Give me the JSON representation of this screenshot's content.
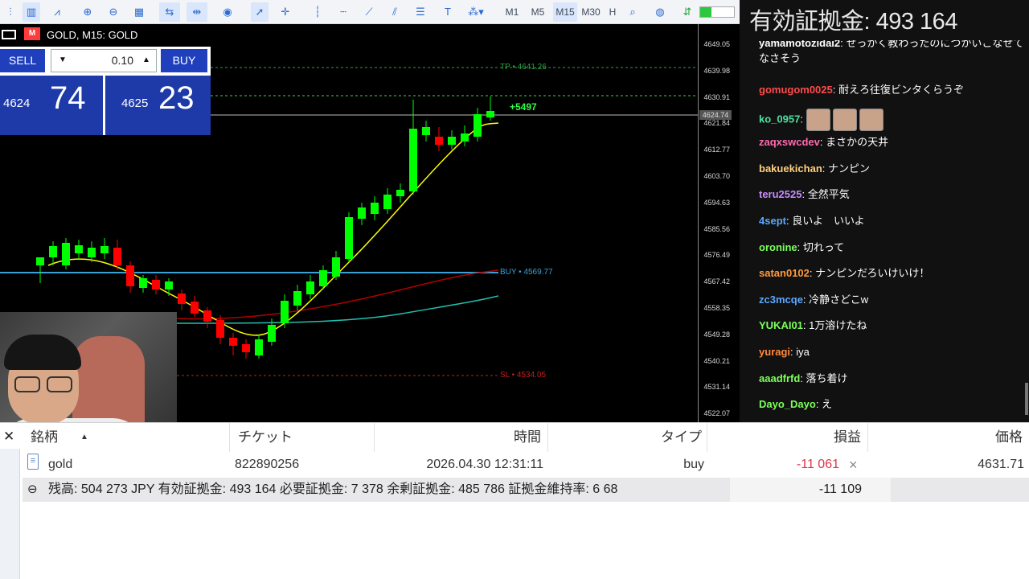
{
  "toolbar": {
    "timeframes": [
      "M1",
      "M5",
      "M15",
      "M30",
      "H"
    ],
    "selected_timeframe": "M15"
  },
  "overlay": {
    "balance_text": "有効証拠金: 493 164"
  },
  "chart": {
    "title": "GOLD, M15: GOLD",
    "sell_label": "SELL",
    "buy_label": "BUY",
    "lot_value": "0.10",
    "bid_small": "4624",
    "bid_big": "74",
    "ask_small": "4625",
    "ask_big": "23",
    "tp_label": "TP • 4641.26",
    "buy_line_label": "BUY • 4569.77",
    "sl_label": "SL • 4534.05",
    "profit_label": "+5497",
    "current_price_tag": "4624.74",
    "price_axis": [
      "4649.05",
      "4639.98",
      "4630.91",
      "4621.84",
      "4612.77",
      "4603.70",
      "4594.63",
      "4585.56",
      "4576.49",
      "4567.42",
      "4558.35",
      "4549.28",
      "4540.21",
      "4531.14",
      "4522.07"
    ],
    "colors": {
      "bull": "#00ff00",
      "bear": "#ff0000",
      "ma_fast": "#ffff00",
      "ma_mid": "#b00000",
      "ma_slow": "#20c0b0",
      "buy_line": "#3aa0d8",
      "tp_line": "#2ea043",
      "sl_line": "#c02020"
    }
  },
  "chat": {
    "messages": [
      {
        "user": "yamamotozidai2",
        "text": "せっかく教わったのにつかいこなせてなさそう",
        "color": "#ffffff"
      },
      {
        "user": "gomugom0025",
        "text": "耐えろ往復ビンタくらうぞ",
        "color": "#ff4a4a"
      },
      {
        "user": "ko_0957",
        "text": "",
        "color": "#4ee0a0",
        "emotes": 3
      },
      {
        "user": "zaqxswcdev",
        "text": "まさかの天井",
        "color": "#ff6ab0"
      },
      {
        "user": "bakuekichan",
        "text": "ナンピン",
        "color": "#ffcf80"
      },
      {
        "user": "teru2525",
        "text": "全然平気",
        "color": "#c88cff"
      },
      {
        "user": "4sept",
        "text": "良いよ　いいよ",
        "color": "#5aa8ff"
      },
      {
        "user": "oronine",
        "text": "切れって",
        "color": "#7cff5a"
      },
      {
        "user": "satan0102",
        "text": "ナンピンだろいけいけ！",
        "color": "#ff9a3c"
      },
      {
        "user": "zc3mcqe",
        "text": "冷静さどこw",
        "color": "#5aa8ff"
      },
      {
        "user": "YUKAI01",
        "text": "1万溶けたね",
        "color": "#7cff5a"
      },
      {
        "user": "yuragi",
        "text": "iya",
        "color": "#ff8a3c"
      },
      {
        "user": "aaadfrfd",
        "text": "落ち着け",
        "color": "#7cff5a"
      },
      {
        "user": "Dayo_Dayo",
        "text": "え",
        "color": "#7cff5a"
      }
    ]
  },
  "positions": {
    "headers": {
      "symbol": "銘柄",
      "ticket": "チケット",
      "time": "時間",
      "type": "タイプ",
      "profit": "損益",
      "price": "価格"
    },
    "row": {
      "symbol": "gold",
      "ticket": "822890256",
      "time": "2026.04.30 12:31:11",
      "type": "buy",
      "profit": "-11 061",
      "price": "4631.71"
    },
    "summary": {
      "text": "残高: 504 273 JPY  有効証拠金: 493 164  必要証拠金: 7 378  余剰証拠金: 485 786  証拠金維持率: 6 68",
      "profit": "-11 109"
    }
  }
}
